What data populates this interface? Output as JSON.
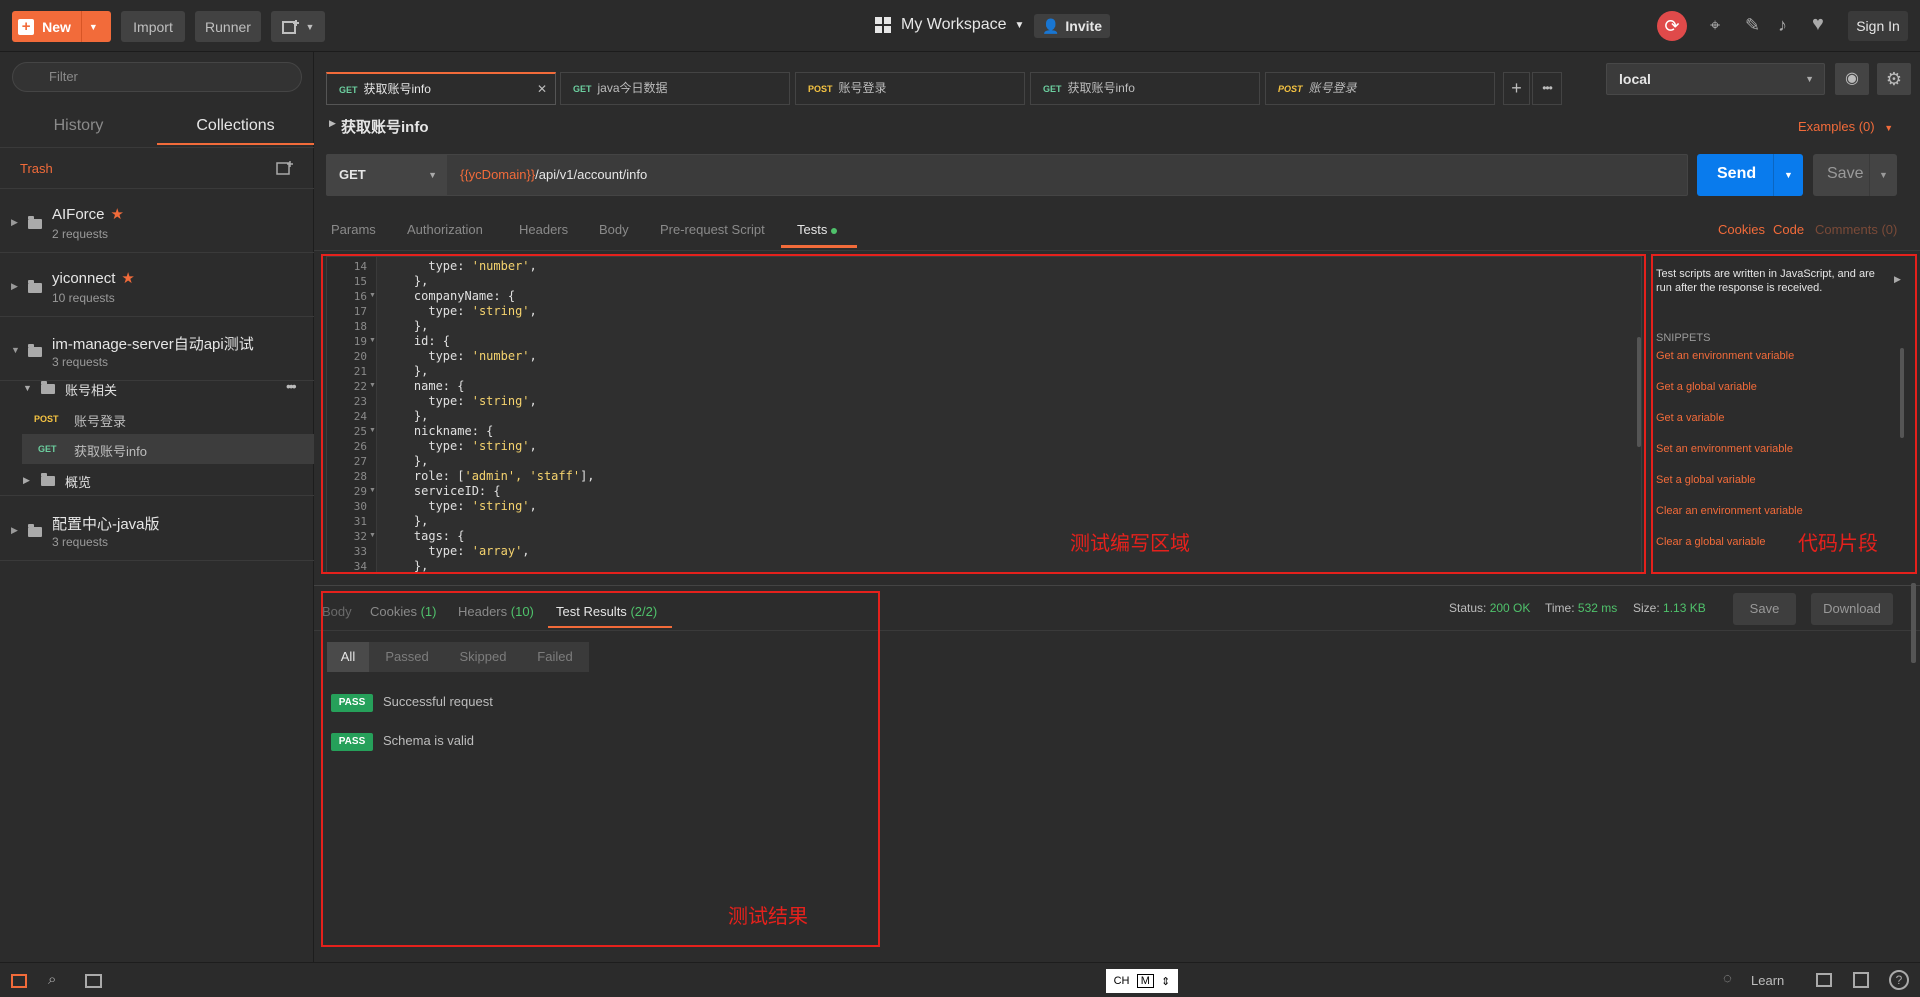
{
  "topbar": {
    "new_label": "New",
    "import_label": "Import",
    "runner_label": "Runner",
    "workspace_label": "My Workspace",
    "invite_label": "Invite",
    "signin_label": "Sign In"
  },
  "sidebar": {
    "filter_placeholder": "Filter",
    "tabs": [
      "History",
      "Collections"
    ],
    "trash_label": "Trash",
    "collections": [
      {
        "name": "AIForce",
        "count": "2 requests",
        "starred": true
      },
      {
        "name": "yiconnect",
        "count": "10 requests",
        "starred": true
      },
      {
        "name": "im-manage-server自动api测试",
        "count": "3 requests",
        "starred": false
      },
      {
        "name": "配置中心-java版",
        "count": "3 requests",
        "starred": false
      }
    ],
    "folder": {
      "name": "账号相关",
      "more": "•••"
    },
    "requests": [
      {
        "method": "POST",
        "name": "账号登录"
      },
      {
        "method": "GET",
        "name": "获取账号info"
      }
    ],
    "subfolder": {
      "name": "概览"
    }
  },
  "tabs": [
    {
      "method": "GET",
      "name": "获取账号info",
      "close": "✕"
    },
    {
      "method": "GET",
      "name": "java今日数据"
    },
    {
      "method": "POST",
      "name": "账号登录"
    },
    {
      "method": "GET",
      "name": "获取账号info"
    },
    {
      "method": "POST",
      "name": "账号登录"
    }
  ],
  "tab_actions": {
    "add": "+",
    "more": "•••"
  },
  "environment": {
    "selected": "local"
  },
  "request": {
    "title": "获取账号info",
    "examples_label": "Examples (0)",
    "method": "GET",
    "url_var": "{{ycDomain}}",
    "url_path": "/api/v1/account/info",
    "send_label": "Send",
    "save_label": "Save"
  },
  "request_tabs": [
    "Params",
    "Authorization",
    "Headers",
    "Body",
    "Pre-request Script",
    "Tests"
  ],
  "request_links": {
    "cookies": "Cookies",
    "code": "Code",
    "comments": "Comments (0)"
  },
  "editor": {
    "lines": [
      {
        "n": "14",
        "indent": "      ",
        "key": "type: ",
        "str": "'number'",
        "tail": ","
      },
      {
        "n": "15",
        "indent": "    ",
        "key": "},",
        "str": "",
        "tail": ""
      },
      {
        "n": "16",
        "indent": "    ",
        "key": "companyName: {",
        "str": "",
        "tail": ""
      },
      {
        "n": "17",
        "indent": "      ",
        "key": "type: ",
        "str": "'string'",
        "tail": ","
      },
      {
        "n": "18",
        "indent": "    ",
        "key": "},",
        "str": "",
        "tail": ""
      },
      {
        "n": "19",
        "indent": "    ",
        "key": "id: {",
        "str": "",
        "tail": ""
      },
      {
        "n": "20",
        "indent": "      ",
        "key": "type: ",
        "str": "'number'",
        "tail": ","
      },
      {
        "n": "21",
        "indent": "    ",
        "key": "},",
        "str": "",
        "tail": ""
      },
      {
        "n": "22",
        "indent": "    ",
        "key": "name: {",
        "str": "",
        "tail": ""
      },
      {
        "n": "23",
        "indent": "      ",
        "key": "type: ",
        "str": "'string'",
        "tail": ","
      },
      {
        "n": "24",
        "indent": "    ",
        "key": "},",
        "str": "",
        "tail": ""
      },
      {
        "n": "25",
        "indent": "    ",
        "key": "nickname: {",
        "str": "",
        "tail": ""
      },
      {
        "n": "26",
        "indent": "      ",
        "key": "type: ",
        "str": "'string'",
        "tail": ","
      },
      {
        "n": "27",
        "indent": "    ",
        "key": "},",
        "str": "",
        "tail": ""
      },
      {
        "n": "28",
        "indent": "    ",
        "key": "role: [",
        "str": "'admin', 'staff'",
        "tail": "],"
      },
      {
        "n": "29",
        "indent": "    ",
        "key": "serviceID: {",
        "str": "",
        "tail": ""
      },
      {
        "n": "30",
        "indent": "      ",
        "key": "type: ",
        "str": "'string'",
        "tail": ","
      },
      {
        "n": "31",
        "indent": "    ",
        "key": "},",
        "str": "",
        "tail": ""
      },
      {
        "n": "32",
        "indent": "    ",
        "key": "tags: {",
        "str": "",
        "tail": ""
      },
      {
        "n": "33",
        "indent": "      ",
        "key": "type: ",
        "str": "'array'",
        "tail": ","
      },
      {
        "n": "34",
        "indent": "    ",
        "key": "},",
        "str": "",
        "tail": ""
      }
    ],
    "annotation": "测试编写区域"
  },
  "snippets": {
    "intro": "Test scripts are written in JavaScript, and are run after the response is received.",
    "heading": "SNIPPETS",
    "items": [
      "Get an environment variable",
      "Get a global variable",
      "Get a variable",
      "Set an environment variable",
      "Set a global variable",
      "Clear an environment variable",
      "Clear a global variable"
    ],
    "annotation": "代码片段"
  },
  "response": {
    "tabs": {
      "body": "Body",
      "cookies": "Cookies",
      "cookies_count": "(1)",
      "headers": "Headers",
      "headers_count": "(10)",
      "results": "Test Results",
      "results_count": "(2/2)"
    },
    "status_label": "Status:",
    "status_value": "200 OK",
    "time_label": "Time:",
    "time_value": "532 ms",
    "size_label": "Size:",
    "size_value": "1.13 KB",
    "save_label": "Save",
    "download_label": "Download",
    "filters": [
      "All",
      "Passed",
      "Skipped",
      "Failed"
    ],
    "results": [
      {
        "badge": "PASS",
        "name": "Successful request"
      },
      {
        "badge": "PASS",
        "name": "Schema is valid"
      }
    ],
    "annotation": "测试结果"
  },
  "statusbar": {
    "ime_lang": "CH",
    "ime_mode": "M",
    "learn_label": "Learn",
    "help": "?"
  }
}
